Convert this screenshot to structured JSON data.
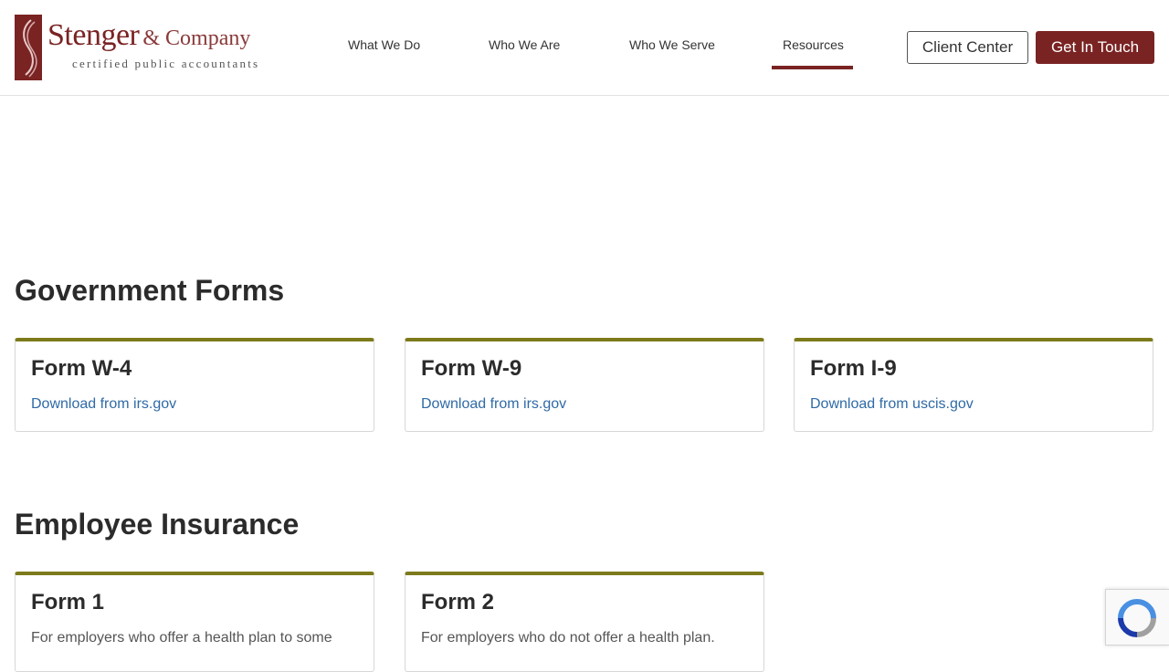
{
  "brand": {
    "name": "Stenger",
    "company": "& Company",
    "tagline": "certified public accountants"
  },
  "nav": {
    "items": [
      {
        "label": "What We Do"
      },
      {
        "label": "Who We Are"
      },
      {
        "label": "Who We Serve"
      },
      {
        "label": "Resources",
        "active": true
      }
    ],
    "client_center_label": "Client Center",
    "get_in_touch_label": "Get In Touch"
  },
  "sections": [
    {
      "title": "Government Forms",
      "cards": [
        {
          "title": "Form W-4",
          "link": "Download from irs.gov"
        },
        {
          "title": "Form W-9",
          "link": "Download from irs.gov"
        },
        {
          "title": "Form I-9",
          "link": "Download from uscis.gov"
        }
      ]
    },
    {
      "title": "Employee Insurance",
      "cards": [
        {
          "title": "Form 1",
          "text": "For employers who offer a health plan to some"
        },
        {
          "title": "Form 2",
          "text": "For employers who do not offer a health plan."
        }
      ]
    }
  ],
  "colors": {
    "brand": "#7a2323",
    "card_accent": "#7d7a1c",
    "link": "#2f6aa6"
  },
  "icons": {
    "logo": "stenger-logo-icon",
    "recaptcha": "recaptcha-icon"
  }
}
